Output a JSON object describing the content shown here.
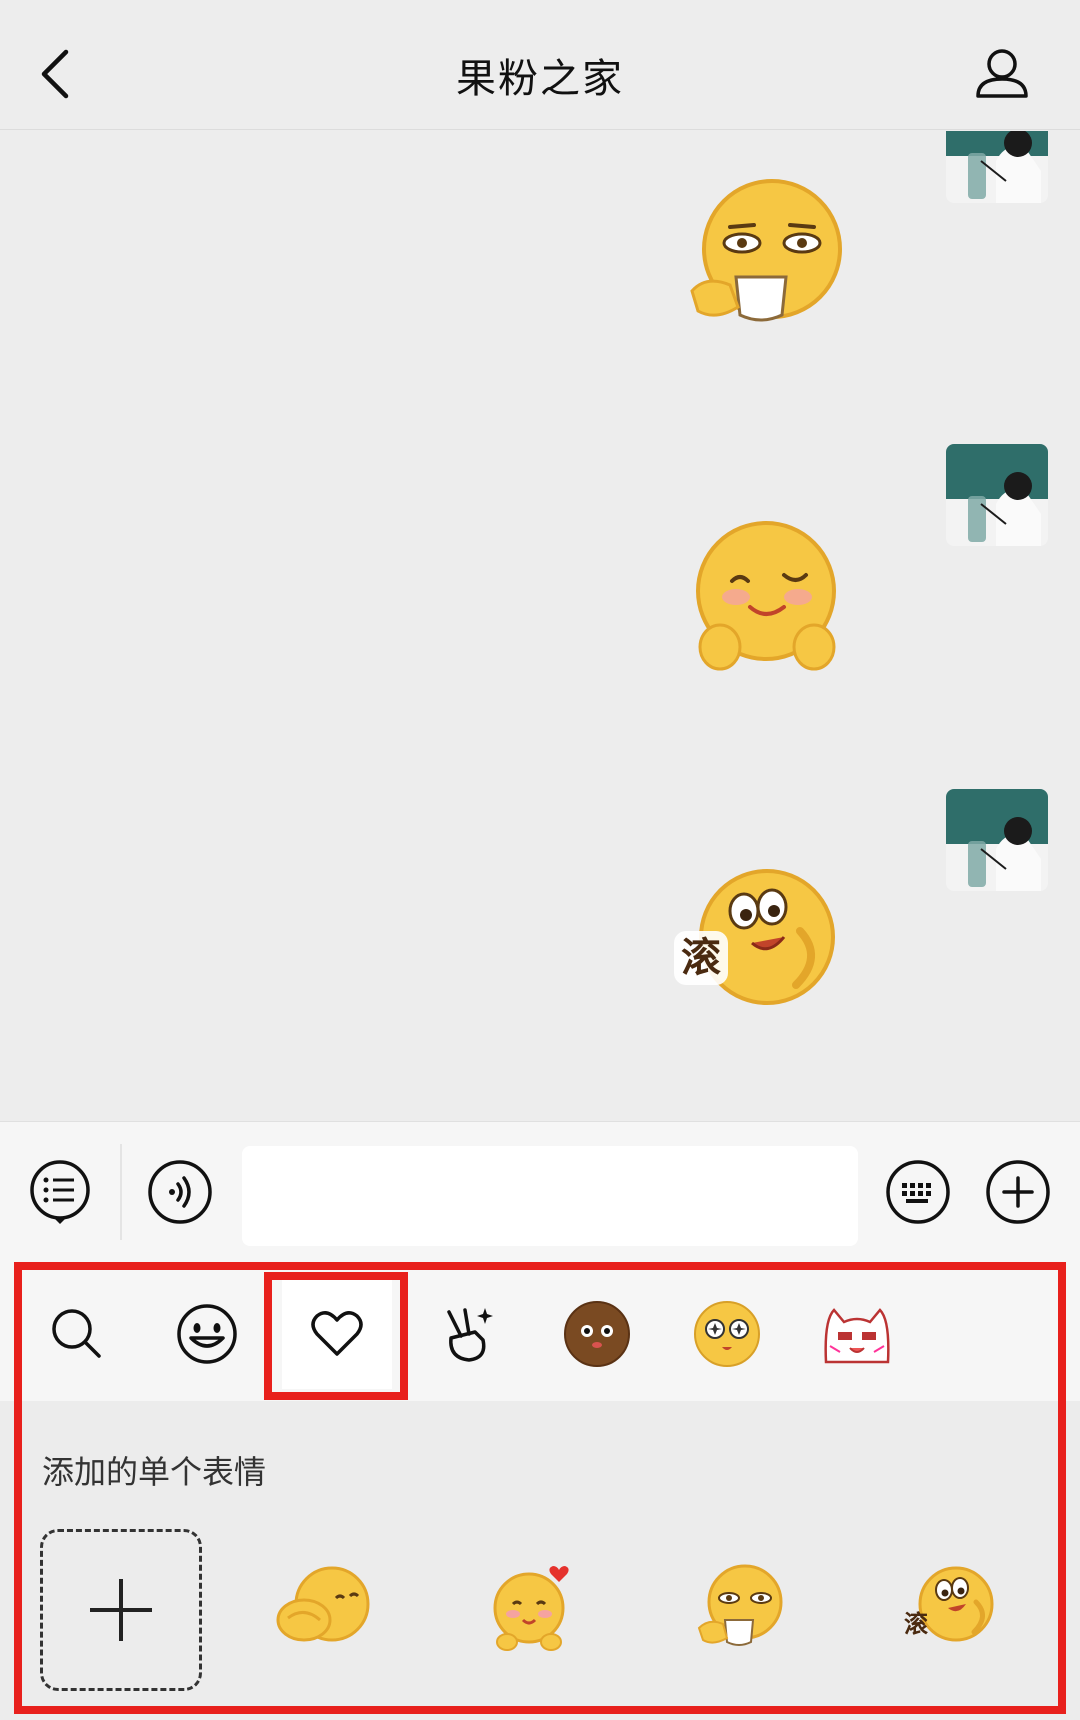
{
  "header": {
    "title": "果粉之家",
    "back_icon": "chevron-left-icon",
    "profile_icon": "person-icon"
  },
  "chat": {
    "messages": [
      {
        "sender": "me",
        "sticker": "sticker-tea-face"
      },
      {
        "sender": "me",
        "sticker": "sticker-wink-heart-hands"
      },
      {
        "sender": "me",
        "sticker": "sticker-roll-away",
        "sticker_text": "滚"
      }
    ]
  },
  "input_bar": {
    "left_icons": [
      "list-bubble-icon",
      "voice-icon"
    ],
    "right_icons": [
      "keyboard-icon",
      "plus-circle-icon"
    ],
    "text_value": ""
  },
  "emoji_panel": {
    "tabs": [
      {
        "icon": "search-icon"
      },
      {
        "icon": "smiley-face-icon"
      },
      {
        "icon": "heart-icon",
        "selected": true
      },
      {
        "icon": "victory-hand-icon"
      },
      {
        "icon": "brown-emoji-icon"
      },
      {
        "icon": "star-eyes-emoji-icon"
      },
      {
        "icon": "cat-emoji-icon"
      }
    ],
    "section_title": "添加的单个表情",
    "items": [
      {
        "type": "add",
        "icon": "plus-icon"
      },
      {
        "type": "sticker",
        "icon": "sticker-hug"
      },
      {
        "type": "sticker",
        "icon": "sticker-heart-blush"
      },
      {
        "type": "sticker",
        "icon": "sticker-tea-face"
      },
      {
        "type": "sticker",
        "icon": "sticker-roll-away",
        "text": "滚"
      }
    ]
  },
  "colors": {
    "background": "#ededed",
    "highlight": "#e8201c",
    "sticker_yellow": "#f7c948"
  }
}
